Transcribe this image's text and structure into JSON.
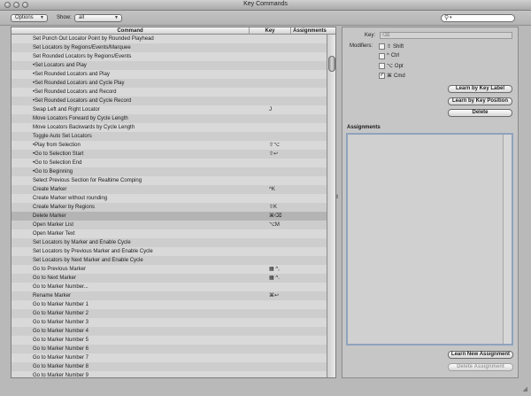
{
  "window": {
    "title": "Key Commands"
  },
  "toolbar": {
    "options_label": "Options",
    "show_label": "Show:",
    "show_value": "all"
  },
  "table": {
    "headers": {
      "command": "Command",
      "key": "Key",
      "assignments": "Assignments"
    },
    "rows": [
      {
        "command": "Set Punch Out Locator Point by Rounded Playhead",
        "key": ""
      },
      {
        "command": "Set Locators by Regions/Events/Marquee",
        "key": ""
      },
      {
        "command": "Set Rounded Locators by Regions/Events",
        "key": ""
      },
      {
        "command": "•Set Locators and Play",
        "key": ""
      },
      {
        "command": "•Set Rounded Locators and Play",
        "key": ""
      },
      {
        "command": "•Set Rounded Locators and Cycle Play",
        "key": ""
      },
      {
        "command": "•Set Rounded Locators and Record",
        "key": ""
      },
      {
        "command": "•Set Rounded Locators and Cycle Record",
        "key": ""
      },
      {
        "command": "Swap Left and Right Locator",
        "key": "J"
      },
      {
        "command": "Move Locators Forward by Cycle Length",
        "key": ""
      },
      {
        "command": "Move Locators Backwards by Cycle Length",
        "key": ""
      },
      {
        "command": "Toggle Auto Set Locators",
        "key": ""
      },
      {
        "command": "•Play from Selection",
        "key": "⇧⌥"
      },
      {
        "command": "•Go to Selection Start",
        "key": "⇧↩"
      },
      {
        "command": "•Go to Selection End",
        "key": ""
      },
      {
        "command": "•Go to Beginning",
        "key": ""
      },
      {
        "command": "Select Previous Section for Realtime Comping",
        "key": ""
      },
      {
        "command": "Create Marker",
        "key": "^K"
      },
      {
        "command": "Create Marker without rounding",
        "key": ""
      },
      {
        "command": "Create Marker by Regions",
        "key": "⇧K"
      },
      {
        "command": "Delete Marker",
        "key": "⌘⌫"
      },
      {
        "command": "Open Marker List",
        "key": "⌥M"
      },
      {
        "command": "Open Marker Text",
        "key": ""
      },
      {
        "command": "Set Locators by Marker and Enable Cycle",
        "key": ""
      },
      {
        "command": "Set Locators by Previous Marker and Enable Cycle",
        "key": ""
      },
      {
        "command": "Set Locators by Next Marker and Enable Cycle",
        "key": ""
      },
      {
        "command": "Go to Previous Marker",
        "key": "▦ ^,"
      },
      {
        "command": "Go to Next Marker",
        "key": "▦ ^."
      },
      {
        "command": "Go to Marker Number...",
        "key": ""
      },
      {
        "command": "Rename Marker",
        "key": "⌘↩"
      },
      {
        "command": "Go to Marker Number 1",
        "key": ""
      },
      {
        "command": "Go to Marker Number 2",
        "key": ""
      },
      {
        "command": "Go to Marker Number 3",
        "key": ""
      },
      {
        "command": "Go to Marker Number 4",
        "key": ""
      },
      {
        "command": "Go to Marker Number 5",
        "key": ""
      },
      {
        "command": "Go to Marker Number 6",
        "key": ""
      },
      {
        "command": "Go to Marker Number 7",
        "key": ""
      },
      {
        "command": "Go to Marker Number 8",
        "key": ""
      },
      {
        "command": "Go to Marker Number 9",
        "key": ""
      }
    ],
    "selected_row": 20
  },
  "details": {
    "key_label": "Key:",
    "key_value": "⌫",
    "modifiers_label": "Modifiers:",
    "modifiers": [
      {
        "symbol": "⇧",
        "name": "Shift",
        "checked": false
      },
      {
        "symbol": "^",
        "name": "Ctrl",
        "checked": false
      },
      {
        "symbol": "⌥",
        "name": "Opt",
        "checked": false
      },
      {
        "symbol": "⌘",
        "name": "Cmd",
        "checked": true
      }
    ],
    "learn_by_label": "Learn by Key Label",
    "learn_by_position": "Learn by Key Position",
    "delete": "Delete",
    "assignments_heading": "Assignments",
    "learn_new_assignment": "Learn New Assignment",
    "delete_assignment": "Delete Assignment"
  },
  "colors": {
    "selection": "#b4b4b4",
    "focus_ring": "#8fa3bd"
  }
}
